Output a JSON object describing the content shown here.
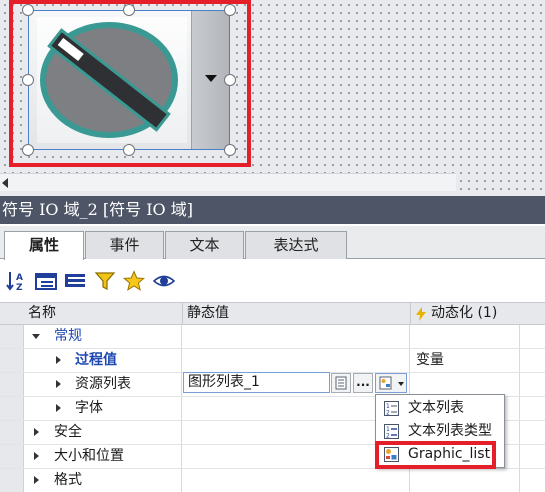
{
  "panel": {
    "title": "符号 IO 域_2 [符号 IO 域]"
  },
  "tabs": [
    {
      "label": "属性",
      "active": true
    },
    {
      "label": "事件",
      "active": false
    },
    {
      "label": "文本",
      "active": false
    },
    {
      "label": "表达式",
      "active": false
    }
  ],
  "toolbar": {
    "icons": [
      "sort-alpha-icon",
      "category-view-icon",
      "list-view-icon",
      "filter-icon",
      "favorites-star-icon",
      "preview-eye-icon"
    ]
  },
  "grid": {
    "columns": {
      "name": "名称",
      "static_value": "静态值",
      "dynamic": "动态化 (1)"
    },
    "rows": [
      {
        "name": "常规",
        "expanded": true,
        "value": "",
        "dynamic": ""
      },
      {
        "name": "过程值",
        "expanded": false,
        "value": "",
        "dynamic": "变量"
      },
      {
        "name": "资源列表",
        "expanded": false,
        "value": "图形列表_1",
        "dynamic": ""
      },
      {
        "name": "字体",
        "expanded": false,
        "value": "",
        "dynamic": ""
      },
      {
        "name": "安全",
        "expanded": false,
        "value": "",
        "dynamic": ""
      },
      {
        "name": "大小和位置",
        "expanded": false,
        "value": "",
        "dynamic": ""
      },
      {
        "name": "格式",
        "expanded": false,
        "value": "",
        "dynamic": ""
      }
    ],
    "more_button": "..."
  },
  "dropdown": {
    "items": [
      {
        "label": "文本列表",
        "icon": "text-list-icon"
      },
      {
        "label": "文本列表类型",
        "icon": "text-list-type-icon"
      },
      {
        "label": "Graphic_list",
        "icon": "graphic-list-icon"
      }
    ]
  },
  "colors": {
    "highlight": "#e41f2a",
    "title_bar": "#4d5566",
    "category_text": "#1f48b3",
    "switch_teal": "#3a9a93"
  }
}
